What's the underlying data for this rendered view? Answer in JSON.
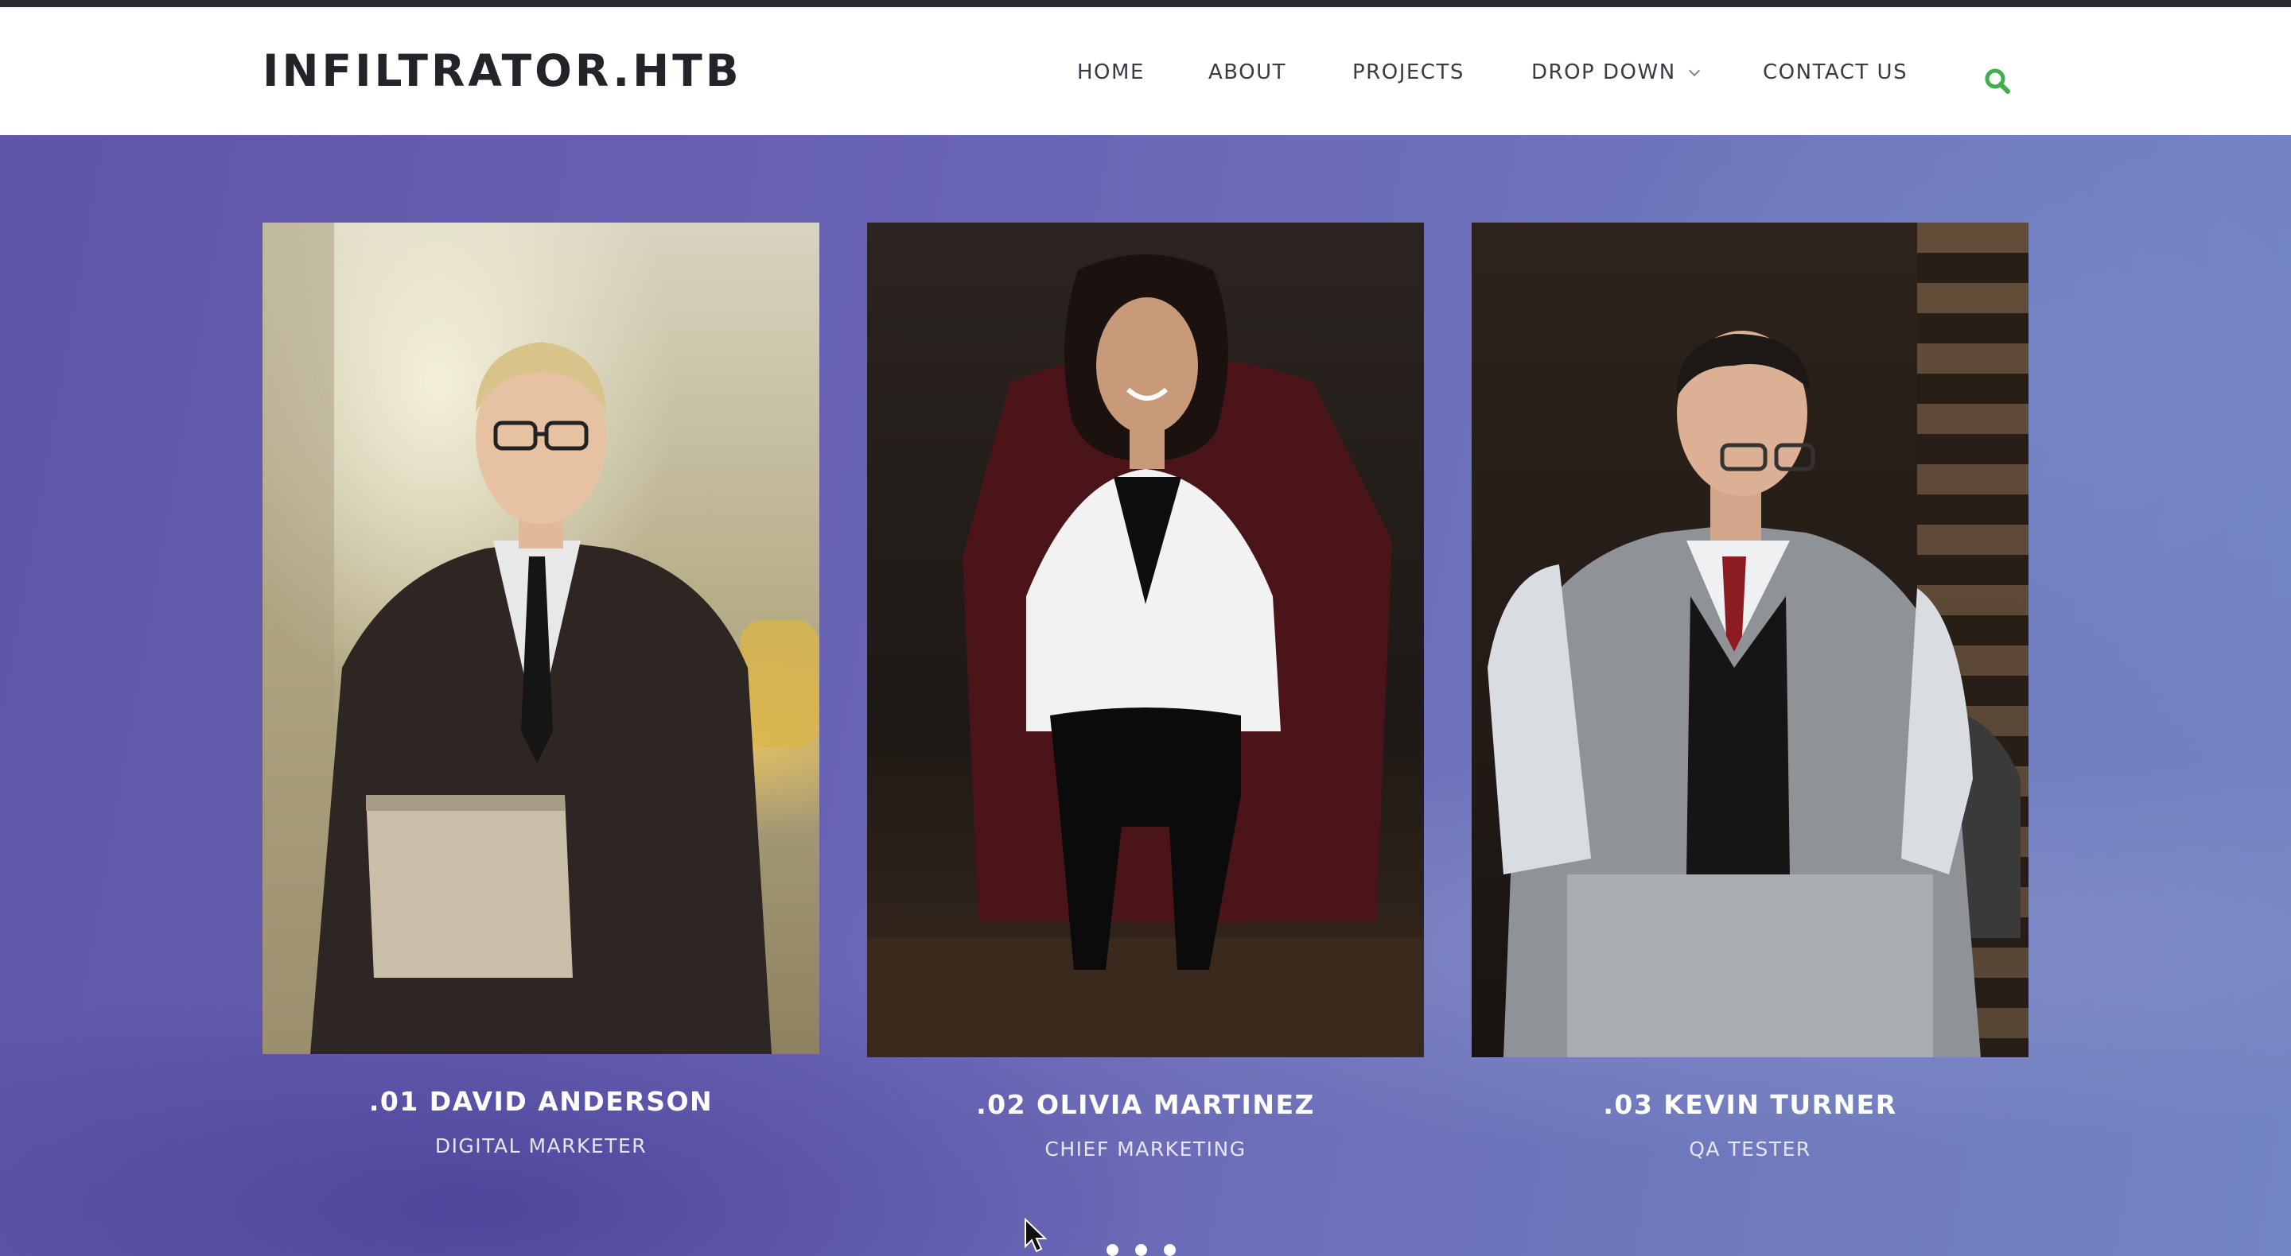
{
  "brand": "INFILTRATOR.HTB",
  "nav": {
    "home": "HOME",
    "about": "ABOUT",
    "projects": "PROJECTS",
    "dropdown": "DROP DOWN",
    "contact": "CONTACT US"
  },
  "search_icon": "search-icon",
  "accent_color": "#3fb04a",
  "team": [
    {
      "name": ".01 DAVID ANDERSON",
      "role": "DIGITAL MARKETER"
    },
    {
      "name": ".02 OLIVIA MARTINEZ",
      "role": "CHIEF MARKETING"
    },
    {
      "name": ".03 KEVIN TURNER",
      "role": "QA TESTER"
    }
  ],
  "carousel": {
    "dots": 3
  }
}
